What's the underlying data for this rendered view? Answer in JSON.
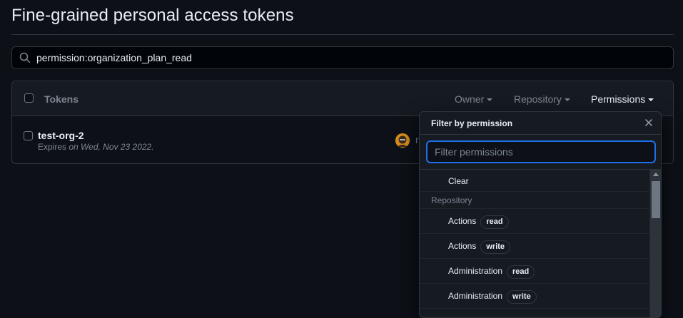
{
  "page": {
    "title": "Fine-grained personal access tokens"
  },
  "search": {
    "value": "permission:organization_plan_read",
    "icon": "search-icon"
  },
  "tokens_table": {
    "header_label": "Tokens",
    "filters": [
      "Owner",
      "Repository",
      "Permissions"
    ],
    "rows": [
      {
        "name": "test-org-2",
        "expires_prefix": "Expires",
        "expires_value": "on Wed, Nov 23 2022.",
        "owner_peek": "r"
      }
    ]
  },
  "permission_popover": {
    "title": "Filter by permission",
    "filter_placeholder": "Filter permissions",
    "clear_label": "Clear",
    "group_label": "Repository",
    "items": [
      {
        "label": "Actions",
        "badge": "read"
      },
      {
        "label": "Actions",
        "badge": "write"
      },
      {
        "label": "Administration",
        "badge": "read"
      },
      {
        "label": "Administration",
        "badge": "write"
      }
    ]
  },
  "colors": {
    "background": "#0d1117",
    "surface": "#161b22",
    "border": "#30363d",
    "text": "#e6edf3",
    "muted": "#7d8590",
    "focus": "#1f6feb"
  }
}
